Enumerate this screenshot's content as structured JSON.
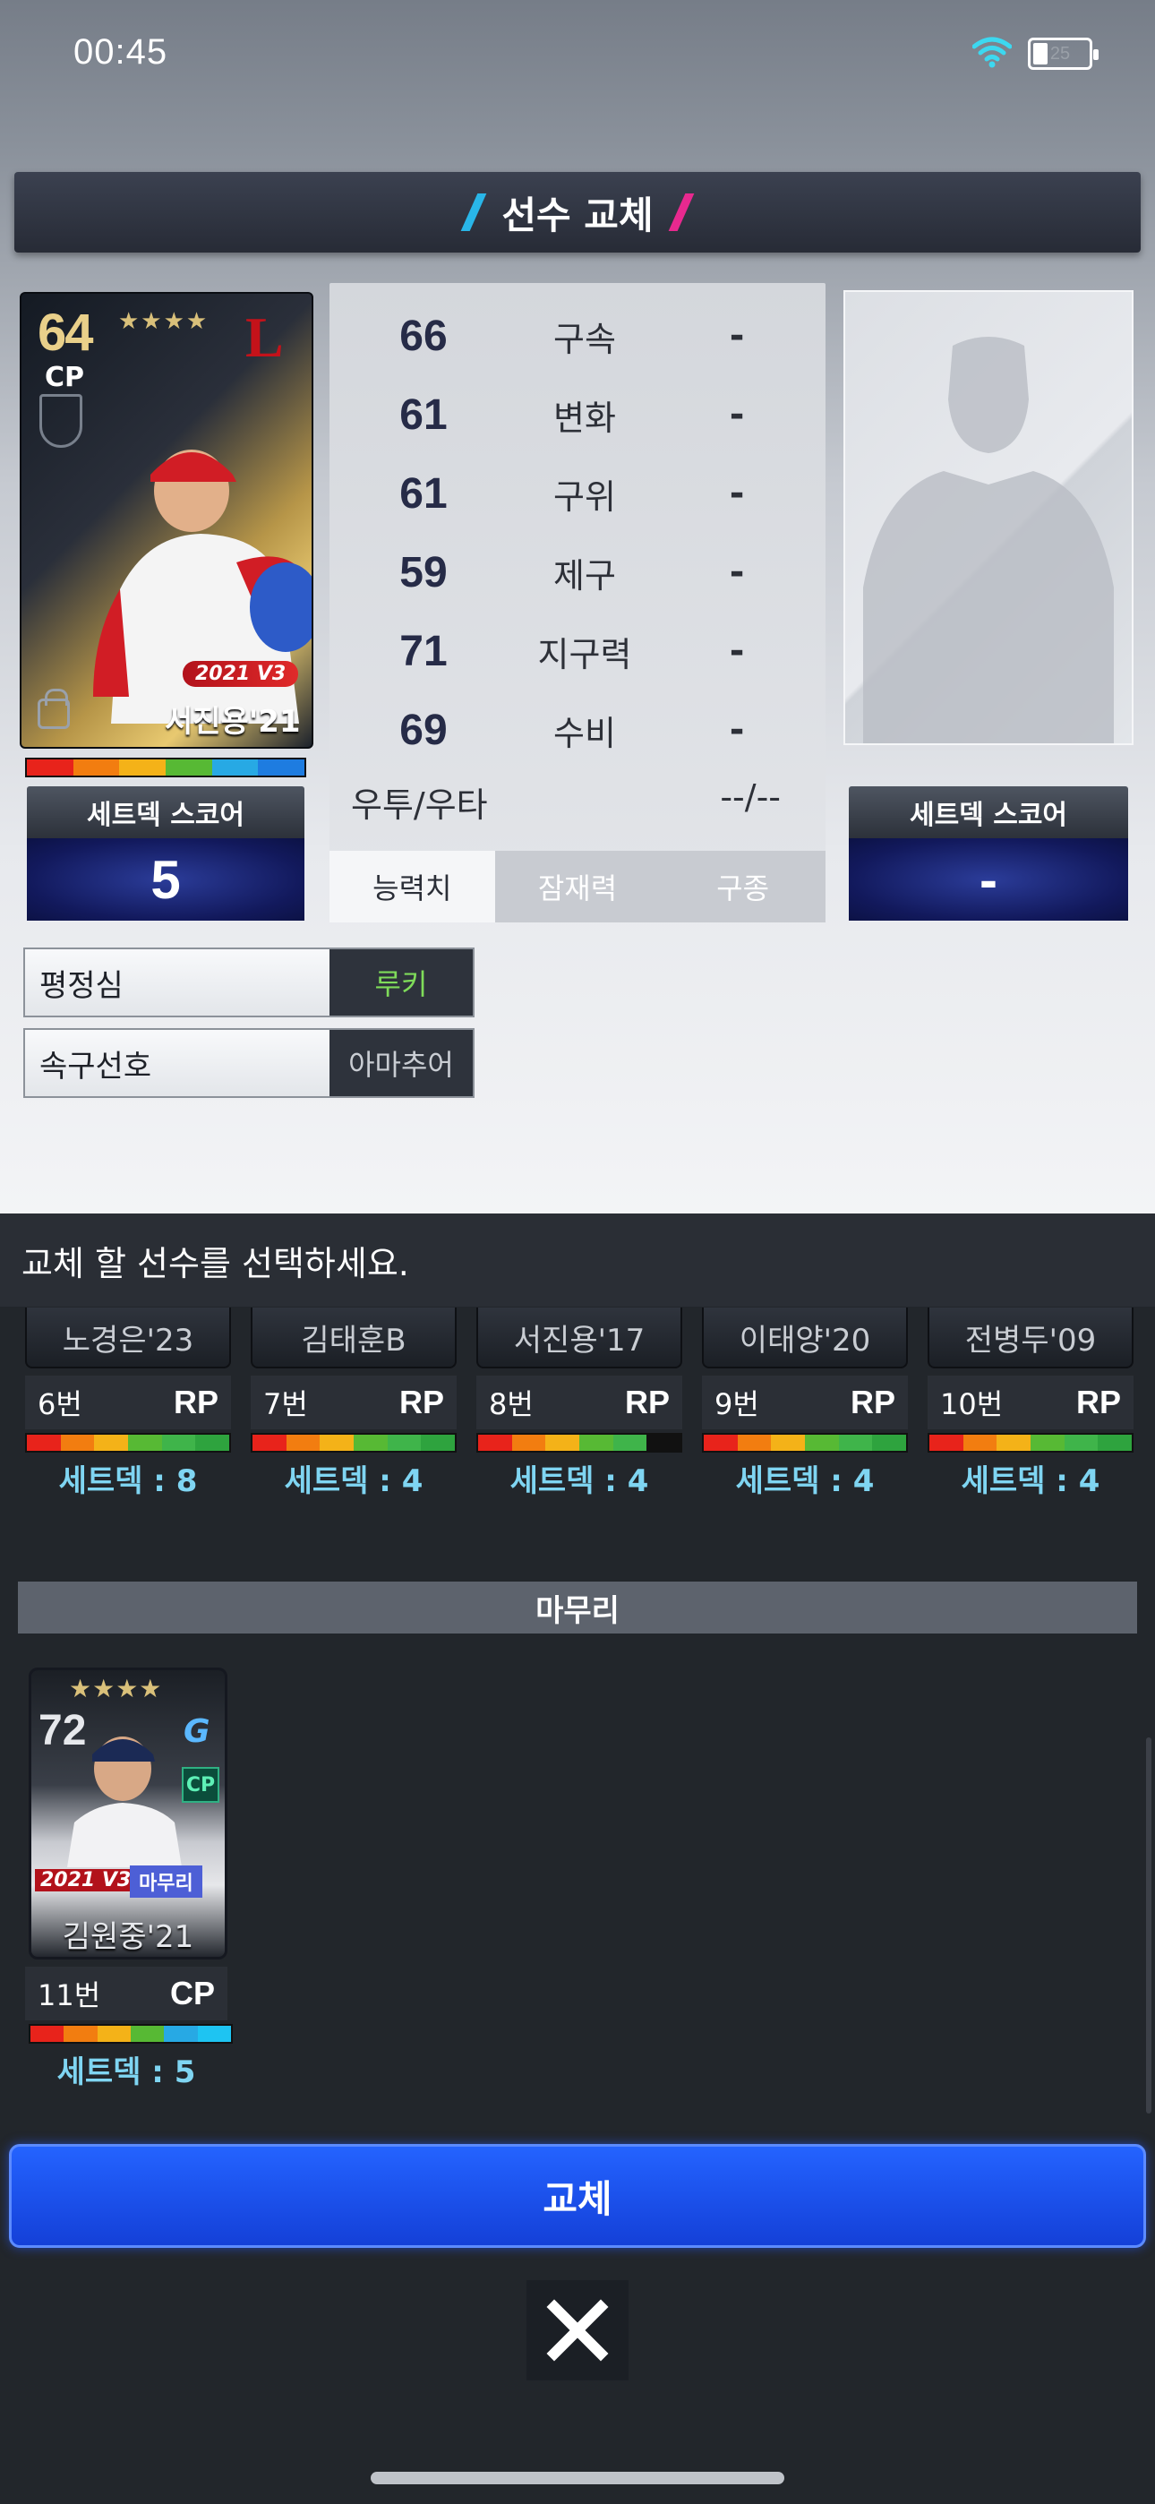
{
  "status_bar": {
    "time": "00:45",
    "battery": "25"
  },
  "header": {
    "title": "선수 교체"
  },
  "current_player": {
    "ovr": "64",
    "position": "CP",
    "stars": "★★★★",
    "logo": "L",
    "badge": "2021 V3",
    "name": "서진용'21",
    "setdeck_label": "세트덱 스코어",
    "setdeck_value": "5"
  },
  "stats": {
    "rows": [
      {
        "value": "66",
        "name": "구속",
        "compare": "-"
      },
      {
        "value": "61",
        "name": "변화",
        "compare": "-"
      },
      {
        "value": "61",
        "name": "구위",
        "compare": "-"
      },
      {
        "value": "59",
        "name": "제구",
        "compare": "-"
      },
      {
        "value": "71",
        "name": "지구력",
        "compare": "-"
      },
      {
        "value": "69",
        "name": "수비",
        "compare": "-"
      }
    ],
    "hand_label": "우투/우타",
    "hand_compare": "--/--",
    "tabs": [
      "능력치",
      "잠재력",
      "구종"
    ]
  },
  "target_player": {
    "setdeck_label": "세트덱 스코어",
    "setdeck_value": "-"
  },
  "info": {
    "rows": [
      {
        "label": "평정심",
        "value": "루키",
        "color": "#7fdc5a"
      },
      {
        "label": "속구선호",
        "value": "아마추어",
        "color": "#c9cdd3"
      }
    ]
  },
  "prompt": "교체 할 선수를 선택하세요.",
  "players": [
    {
      "name": "노경은'23",
      "number": "6번",
      "position": "RP",
      "setdeck": "세트덱 : 8"
    },
    {
      "name": "김태훈B",
      "number": "7번",
      "position": "RP",
      "setdeck": "세트덱 : 4"
    },
    {
      "name": "서진용'17",
      "number": "8번",
      "position": "RP",
      "setdeck": "세트덱 : 4"
    },
    {
      "name": "이태양'20",
      "number": "9번",
      "position": "RP",
      "setdeck": "세트덱 : 4"
    },
    {
      "name": "전병두'09",
      "number": "10번",
      "position": "RP",
      "setdeck": "세트덱 : 4"
    }
  ],
  "closer_section": {
    "title": "마무리",
    "card": {
      "stars": "★★★★",
      "ovr": "72",
      "logo": "G",
      "position_badge": "CP",
      "year_badge": "2021 V3",
      "role_badge": "마무리",
      "name": "김원중'21",
      "number": "11번",
      "position": "CP",
      "setdeck": "세트덱 : 5"
    }
  },
  "buttons": {
    "swap": "교체",
    "close": "close"
  },
  "colors": {
    "accent_blue": "#2463ff",
    "slash_cyan": "#29b6e8",
    "slash_magenta": "#e8298f",
    "setdeck_text": "#7fd5f2"
  }
}
